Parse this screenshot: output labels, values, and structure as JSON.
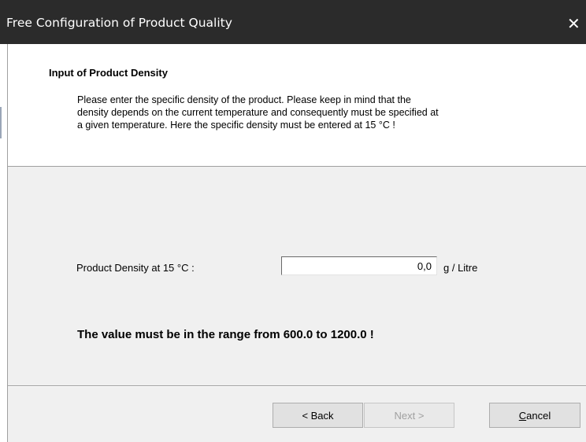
{
  "window": {
    "title": "Free Configuration of Product Quality",
    "close_glyph": "✕"
  },
  "header": {
    "title": "Input of Product Density",
    "description_lines": [
      "Please enter the specific density of the product. Please keep in mind that the",
      "density depends on the current temperature and consequently must be specified at",
      "a given temperature. Here the specific density must be entered at 15 °C !"
    ]
  },
  "form": {
    "density_label": "Product Density at 15 °C :",
    "density_value": "0,0",
    "unit": "g / Litre",
    "range_note": "The value must be in the range from 600.0 to 1200.0 !"
  },
  "buttons": {
    "back": "< Back",
    "next": "Next >",
    "cancel_mnemonic": "C",
    "cancel_rest": "ancel"
  },
  "colors": {
    "titlebar": "#2b2b2b",
    "dialog_bg": "#f0f0f0",
    "header_bg": "#ffffff"
  }
}
